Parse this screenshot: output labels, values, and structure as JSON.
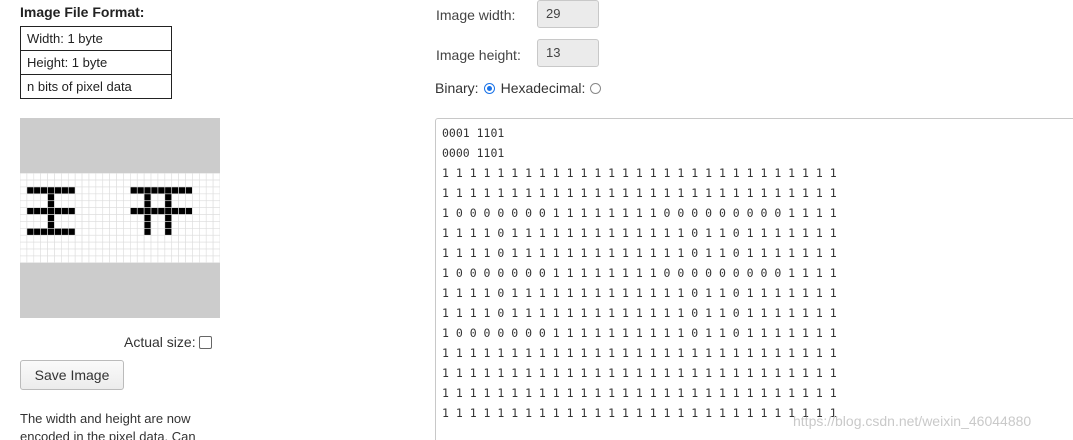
{
  "format": {
    "title": "Image File Format:",
    "rows": [
      "Width: 1 byte",
      "Height: 1 byte",
      "n bits of pixel data"
    ]
  },
  "preview": {
    "actual_size_label": "Actual size:",
    "actual_size_checked": false
  },
  "save_button_label": "Save Image",
  "note_text": "The width and height are now encoded in the pixel data. Can",
  "settings": {
    "width_label": "Image width:",
    "width_value": "29",
    "height_label": "Image height:",
    "height_value": "13",
    "binary_label": "Binary:",
    "hex_label": "Hexadecimal:",
    "selected_mode": "binary"
  },
  "pixel_data": {
    "header_lines": [
      "0001 1101",
      "0000 1101"
    ],
    "rows": [
      "1 1 1 1 1 1 1 1 1 1 1 1 1 1 1 1 1 1 1 1 1 1 1 1 1 1 1 1 1",
      "1 1 1 1 1 1 1 1 1 1 1 1 1 1 1 1 1 1 1 1 1 1 1 1 1 1 1 1 1",
      "1 0 0 0 0 0 0 0 1 1 1 1 1 1 1 1 0 0 0 0 0 0 0 0 0 1 1 1 1",
      "1 1 1 1 0 1 1 1 1 1 1 1 1 1 1 1 1 1 0 1 1 0 1 1 1 1 1 1 1",
      "1 1 1 1 0 1 1 1 1 1 1 1 1 1 1 1 1 1 0 1 1 0 1 1 1 1 1 1 1",
      "1 0 0 0 0 0 0 0 1 1 1 1 1 1 1 1 0 0 0 0 0 0 0 0 0 1 1 1 1",
      "1 1 1 1 0 1 1 1 1 1 1 1 1 1 1 1 1 1 0 1 1 0 1 1 1 1 1 1 1",
      "1 1 1 1 0 1 1 1 1 1 1 1 1 1 1 1 1 1 0 1 1 0 1 1 1 1 1 1 1",
      "1 0 0 0 0 0 0 0 1 1 1 1 1 1 1 1 1 1 0 1 1 0 1 1 1 1 1 1 1",
      "1 1 1 1 1 1 1 1 1 1 1 1 1 1 1 1 1 1 1 1 1 1 1 1 1 1 1 1 1",
      "1 1 1 1 1 1 1 1 1 1 1 1 1 1 1 1 1 1 1 1 1 1 1 1 1 1 1 1 1",
      "1 1 1 1 1 1 1 1 1 1 1 1 1 1 1 1 1 1 1 1 1 1 1 1 1 1 1 1 1",
      "1 1 1 1 1 1 1 1 1 1 1 1 1 1 1 1 1 1 1 1 1 1 1 1 1 1 1 1 1"
    ]
  },
  "watermark": "https://blog.csdn.net/weixin_46044880",
  "colors": {
    "accent": "#1a73e8",
    "pixel_on": "#000000",
    "pixel_off": "#ffffff",
    "grid": "#dddddd",
    "preview_bg": "#cccccc"
  }
}
